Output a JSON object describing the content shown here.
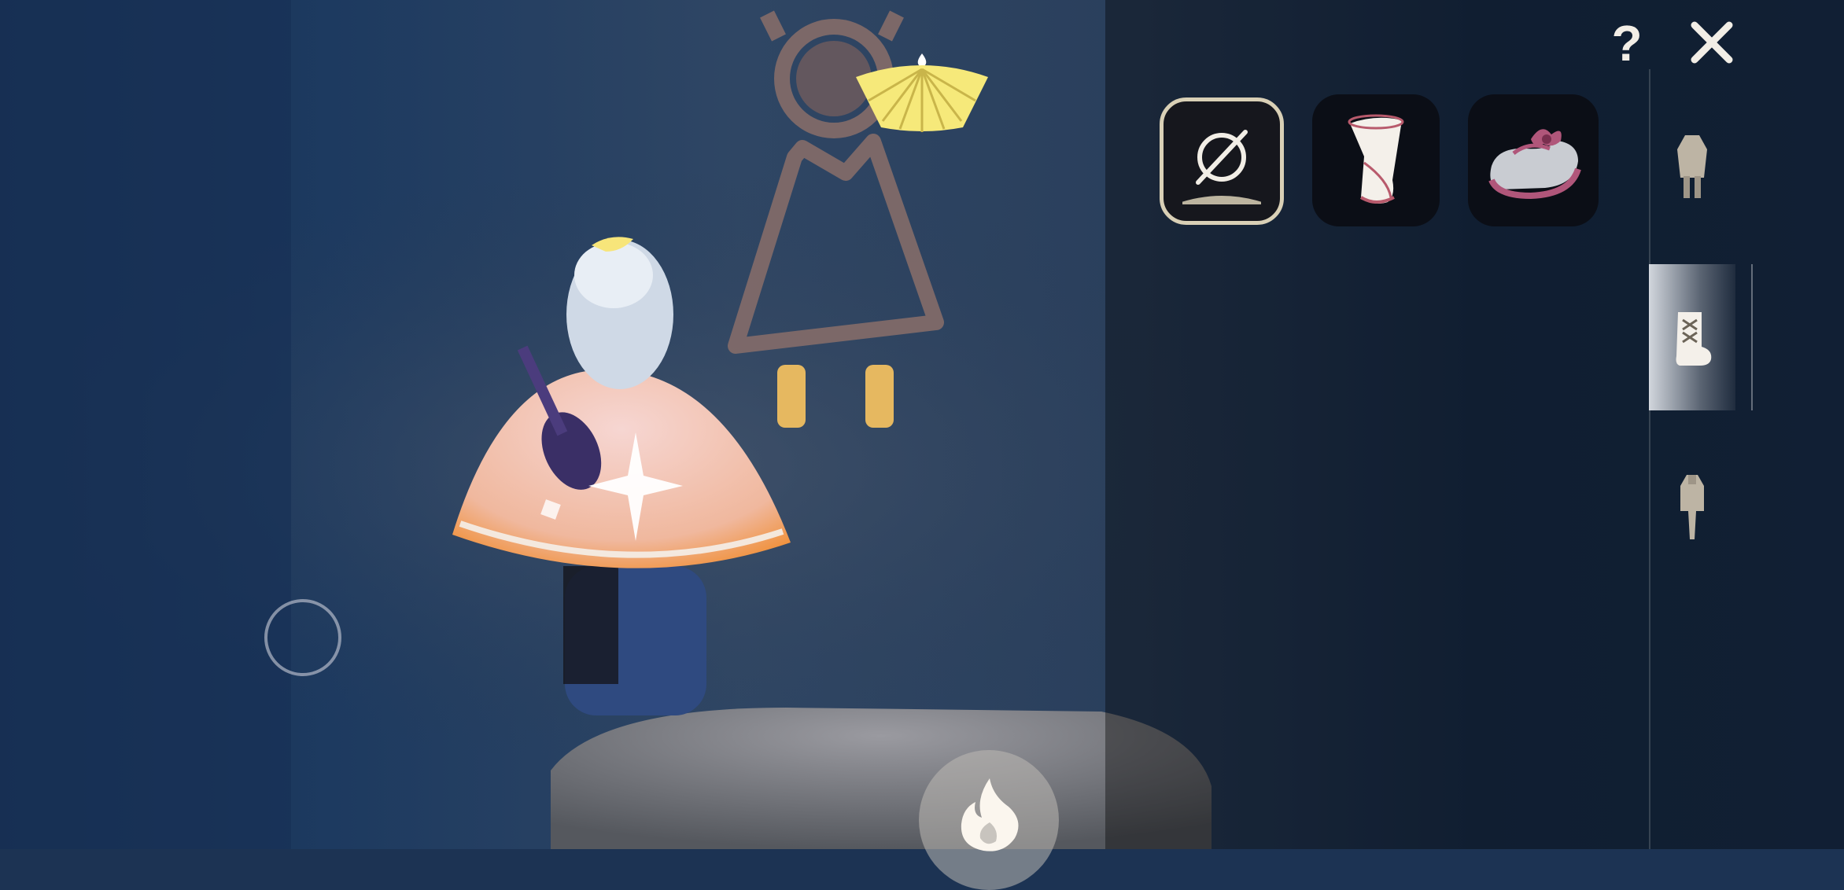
{
  "hud": {
    "help_label": "?",
    "close_icon": "close-icon",
    "joystick_icon": "joystick-ring",
    "action_icon": "flame-icon",
    "cape_energy_icon": "cape-wing-fan-icon"
  },
  "item_options": [
    {
      "icon": "none-slash-icon",
      "selected": true
    },
    {
      "icon": "boot-sock-icon",
      "selected": false
    },
    {
      "icon": "ribbon-shoe-icon",
      "selected": false
    }
  ],
  "categories": [
    {
      "icon": "outfit-icon",
      "active": false
    },
    {
      "icon": "boots-icon",
      "active": true
    },
    {
      "icon": "pants-icon",
      "active": false
    }
  ],
  "colors": {
    "accent_gold": "#f6e97a",
    "slot_border_selected": "#d9d0b6",
    "icon_cream": "#f2eee6",
    "shoe_pink": "#b0567a"
  }
}
